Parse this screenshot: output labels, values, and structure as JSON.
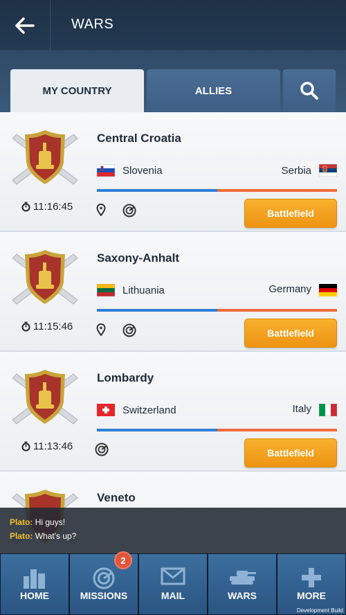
{
  "header": {
    "title": "WARS"
  },
  "tabs": [
    {
      "label": "MY COUNTRY",
      "active": true
    },
    {
      "label": "ALLIES",
      "active": false
    }
  ],
  "wars": [
    {
      "region": "Central Croatia",
      "attacker": "Slovenia",
      "defender": "Serbia",
      "timer": "11:16:45",
      "has_pin": true,
      "action": "Battlefield"
    },
    {
      "region": "Saxony-Anhalt",
      "attacker": "Lithuania",
      "defender": "Germany",
      "timer": "11:15:46",
      "has_pin": true,
      "action": "Battlefield"
    },
    {
      "region": "Lombardy",
      "attacker": "Switzerland",
      "defender": "Italy",
      "timer": "11:13:46",
      "has_pin": false,
      "action": "Battlefield"
    },
    {
      "region": "Veneto"
    }
  ],
  "chat": [
    {
      "user": "Plato:",
      "text": "Hi guys!"
    },
    {
      "user": "Plato:",
      "text": "What's up?"
    }
  ],
  "nav": [
    {
      "label": "HOME"
    },
    {
      "label": "MISSIONS",
      "badge": "2"
    },
    {
      "label": "MAIL"
    },
    {
      "label": "WARS"
    },
    {
      "label": "MORE"
    }
  ],
  "footer": {
    "dev_build": "Development Build"
  },
  "colors": {
    "attacker_bar": "#2f7fd9",
    "defender_bar": "#ef6b3b",
    "button": "#f4a321",
    "nav": "#336493"
  }
}
